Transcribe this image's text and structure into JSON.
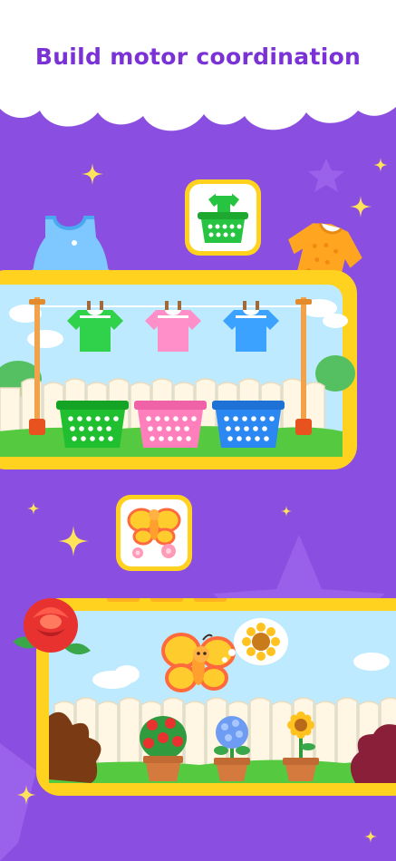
{
  "header": {
    "title": "Build motor coordination"
  },
  "colors": {
    "background": "#8a4fe0",
    "header_bg": "#ffffff",
    "title_text": "#7a32d6",
    "panel_border": "#ffd21f",
    "sparkle": "#ffe35a",
    "sky": "#bdeaff",
    "grass": "#55c93f"
  },
  "scenes": [
    {
      "name": "laundry-sorting",
      "icon": "laundry-basket-icon",
      "shirts": [
        {
          "color": "#31d24b"
        },
        {
          "color": "#ff8fc8"
        },
        {
          "color": "#3ba3ff"
        }
      ],
      "baskets": [
        {
          "color": "#1fbf2f"
        },
        {
          "color": "#ff7fbd"
        },
        {
          "color": "#2b88f2"
        }
      ]
    },
    {
      "name": "butterfly-garden",
      "icon": "butterfly-icon",
      "flowers": [
        {
          "name": "red-rose-bush-icon"
        },
        {
          "name": "blue-hydrangea-icon"
        },
        {
          "name": "sunflower-icon"
        }
      ]
    }
  ]
}
